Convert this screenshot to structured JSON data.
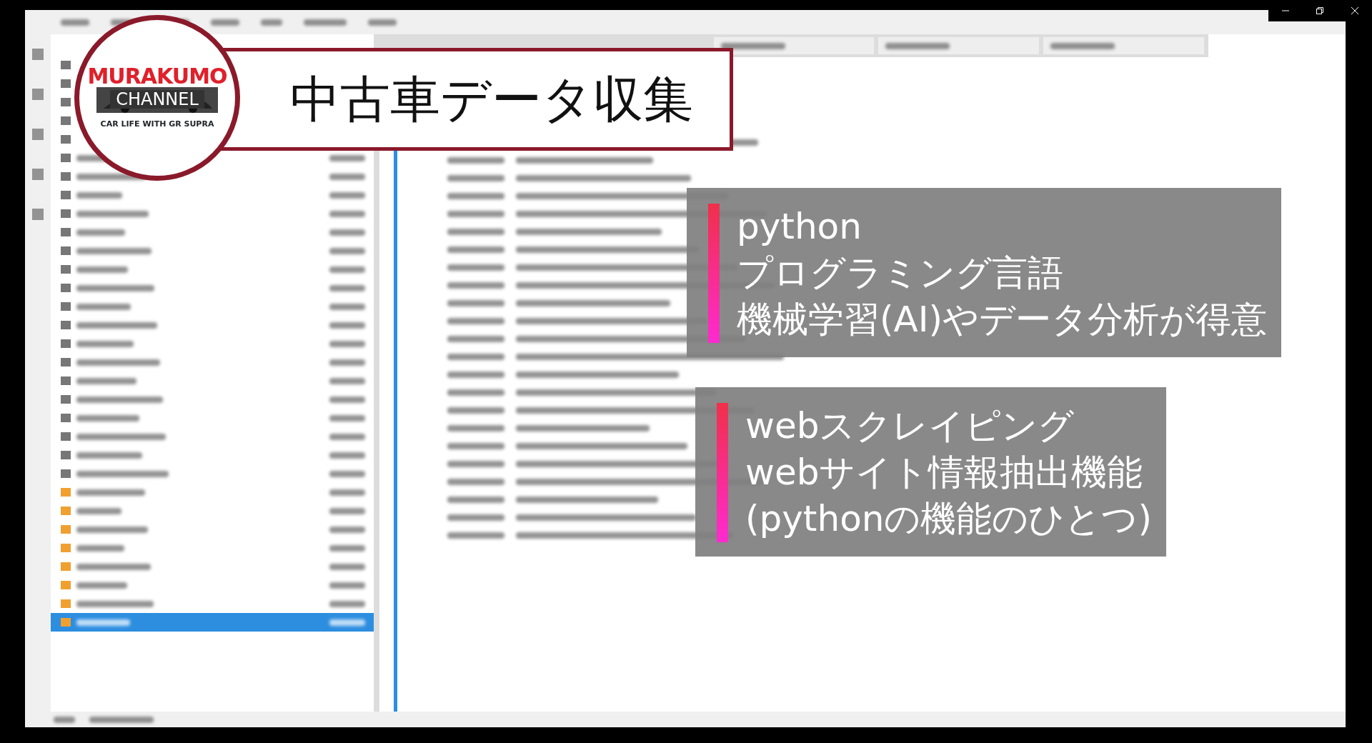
{
  "title": "中古車データ収集",
  "logo": {
    "name": "MURAKUMO",
    "subtitle": "CHANNEL",
    "tagline": "CAR LIFE WITH GR SUPRA"
  },
  "overlays": [
    {
      "lines": [
        "python",
        "プログラミング言語",
        "機械学習(AI)やデータ分析が得意"
      ]
    },
    {
      "lines": [
        "webスクレイピング",
        "webサイト情報抽出機能",
        "(pythonの機能のひとつ)"
      ]
    }
  ],
  "file_tree": {
    "rows": [
      {
        "selected": false
      },
      {
        "selected": false
      },
      {
        "selected": false
      },
      {
        "selected": false
      },
      {
        "selected": false
      },
      {
        "selected": false
      },
      {
        "selected": false
      },
      {
        "selected": false
      },
      {
        "selected": false
      },
      {
        "selected": false
      },
      {
        "selected": false
      },
      {
        "selected": false
      },
      {
        "selected": false
      },
      {
        "selected": false
      },
      {
        "selected": false
      },
      {
        "selected": false
      },
      {
        "selected": false
      },
      {
        "selected": false
      },
      {
        "selected": false
      },
      {
        "selected": false
      },
      {
        "selected": false
      },
      {
        "selected": false
      },
      {
        "selected": false
      },
      {
        "selected": false
      },
      {
        "selected": false
      },
      {
        "selected": true
      }
    ]
  }
}
